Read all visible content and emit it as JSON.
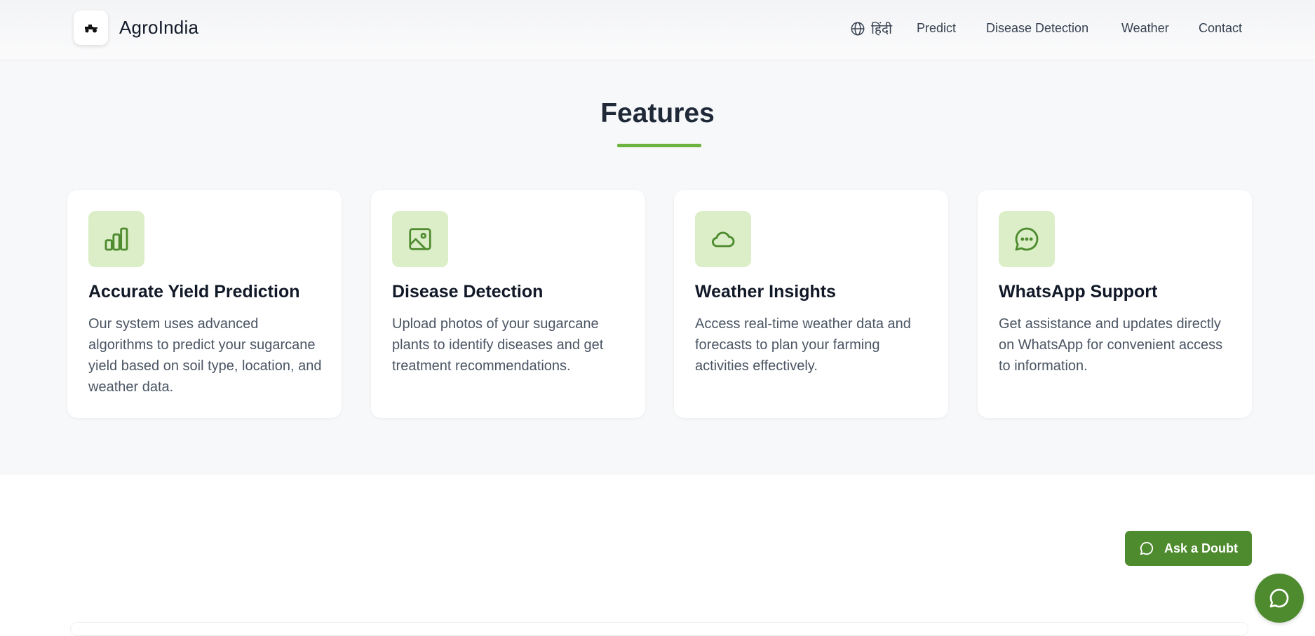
{
  "header": {
    "brand": "AgroIndia",
    "logo_icon": "tractor-icon",
    "language_label": "हिंदी",
    "language_icon": "globe-icon",
    "nav": [
      {
        "label": "Predict"
      },
      {
        "label": "Disease Detection"
      },
      {
        "label": "Weather"
      },
      {
        "label": "Contact"
      }
    ]
  },
  "features": {
    "title": "Features",
    "accent_color": "#6cb33f",
    "icon_bg_color": "#dbeec7",
    "icon_color": "#4e8a2e",
    "cards": [
      {
        "icon": "bar-chart-icon",
        "title": "Accurate Yield Prediction",
        "description": "Our system uses advanced algorithms to predict your sugarcane yield based on soil type, location, and weather data."
      },
      {
        "icon": "image-icon",
        "title": "Disease Detection",
        "description": "Upload photos of your sugarcane plants to identify diseases and get treatment recommendations."
      },
      {
        "icon": "cloud-icon",
        "title": "Weather Insights",
        "description": "Access real-time weather data and forecasts to plan your farming activities effectively."
      },
      {
        "icon": "message-dots-icon",
        "title": "WhatsApp Support",
        "description": "Get assistance and updates directly on WhatsApp for convenient access to information."
      }
    ]
  },
  "ask_doubt": {
    "label": "Ask a Doubt",
    "icon": "chat-bubble-icon",
    "color": "#4e8a2e"
  },
  "chat_fab": {
    "icon": "chat-bubble-icon"
  }
}
